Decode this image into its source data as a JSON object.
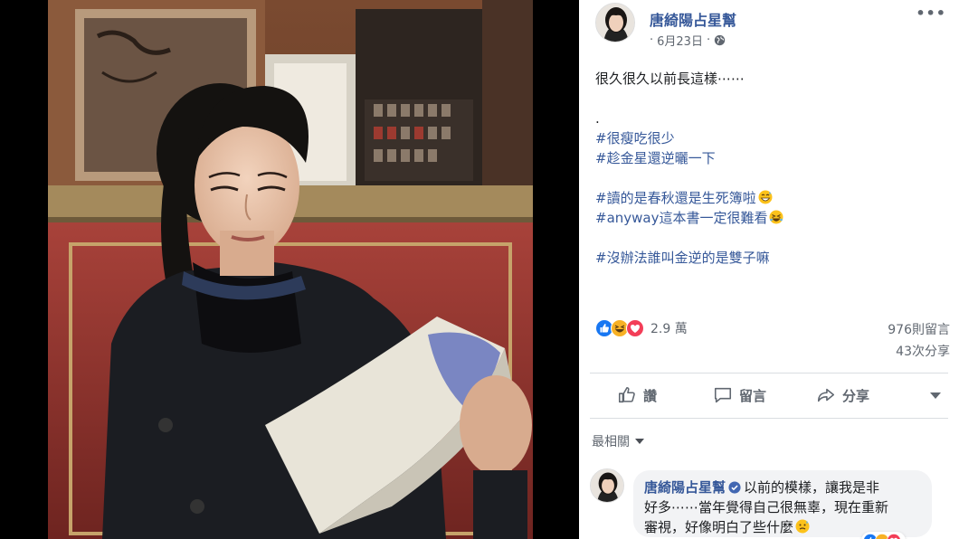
{
  "post": {
    "author": "唐綺陽占星幫",
    "date": "6月23日",
    "date_separator": "·",
    "more_label": "•••",
    "lines": [
      {
        "text": "很久很久以前長這樣⋯⋯",
        "kind": "text"
      },
      {
        "text": "",
        "kind": "blank"
      },
      {
        "text": ".",
        "kind": "text"
      },
      {
        "text": "#很瘦吃很少",
        "kind": "hashtag"
      },
      {
        "text": "#趁金星還逆曬一下",
        "kind": "hashtag"
      },
      {
        "text": "",
        "kind": "blank"
      },
      {
        "text": "#讀的是春秋還是生死簿啦",
        "kind": "hashtag",
        "emoji": "grin-sweat-emoji"
      },
      {
        "text": "#anyway這本書一定很難看",
        "kind": "hashtag",
        "emoji": "rofl-emoji"
      },
      {
        "text": "",
        "kind": "blank"
      },
      {
        "text": "#沒辦法誰叫金逆的是雙子嘛",
        "kind": "hashtag"
      }
    ]
  },
  "stats": {
    "reactions_count": "2.9 萬",
    "reaction_icons": [
      "like-reaction-icon",
      "haha-reaction-icon",
      "love-reaction-icon"
    ],
    "comments": "976則留言",
    "shares": "43次分享"
  },
  "actions": {
    "like": "讚",
    "comment": "留言",
    "share": "分享"
  },
  "filter": {
    "label": "最相關"
  },
  "comment": {
    "author": "唐綺陽占星幫",
    "line1": "以前的模樣，讓我是非",
    "line2": "好多⋯⋯當年覺得自己很無辜，現在重新",
    "line3": "審視，好像明白了些什麼",
    "emoji": "thinking-sweat-emoji"
  },
  "colors": {
    "link_blue": "#365899",
    "like_blue": "#1877f2",
    "love_red": "#f33e58",
    "haha_yellow": "#f7b125"
  }
}
